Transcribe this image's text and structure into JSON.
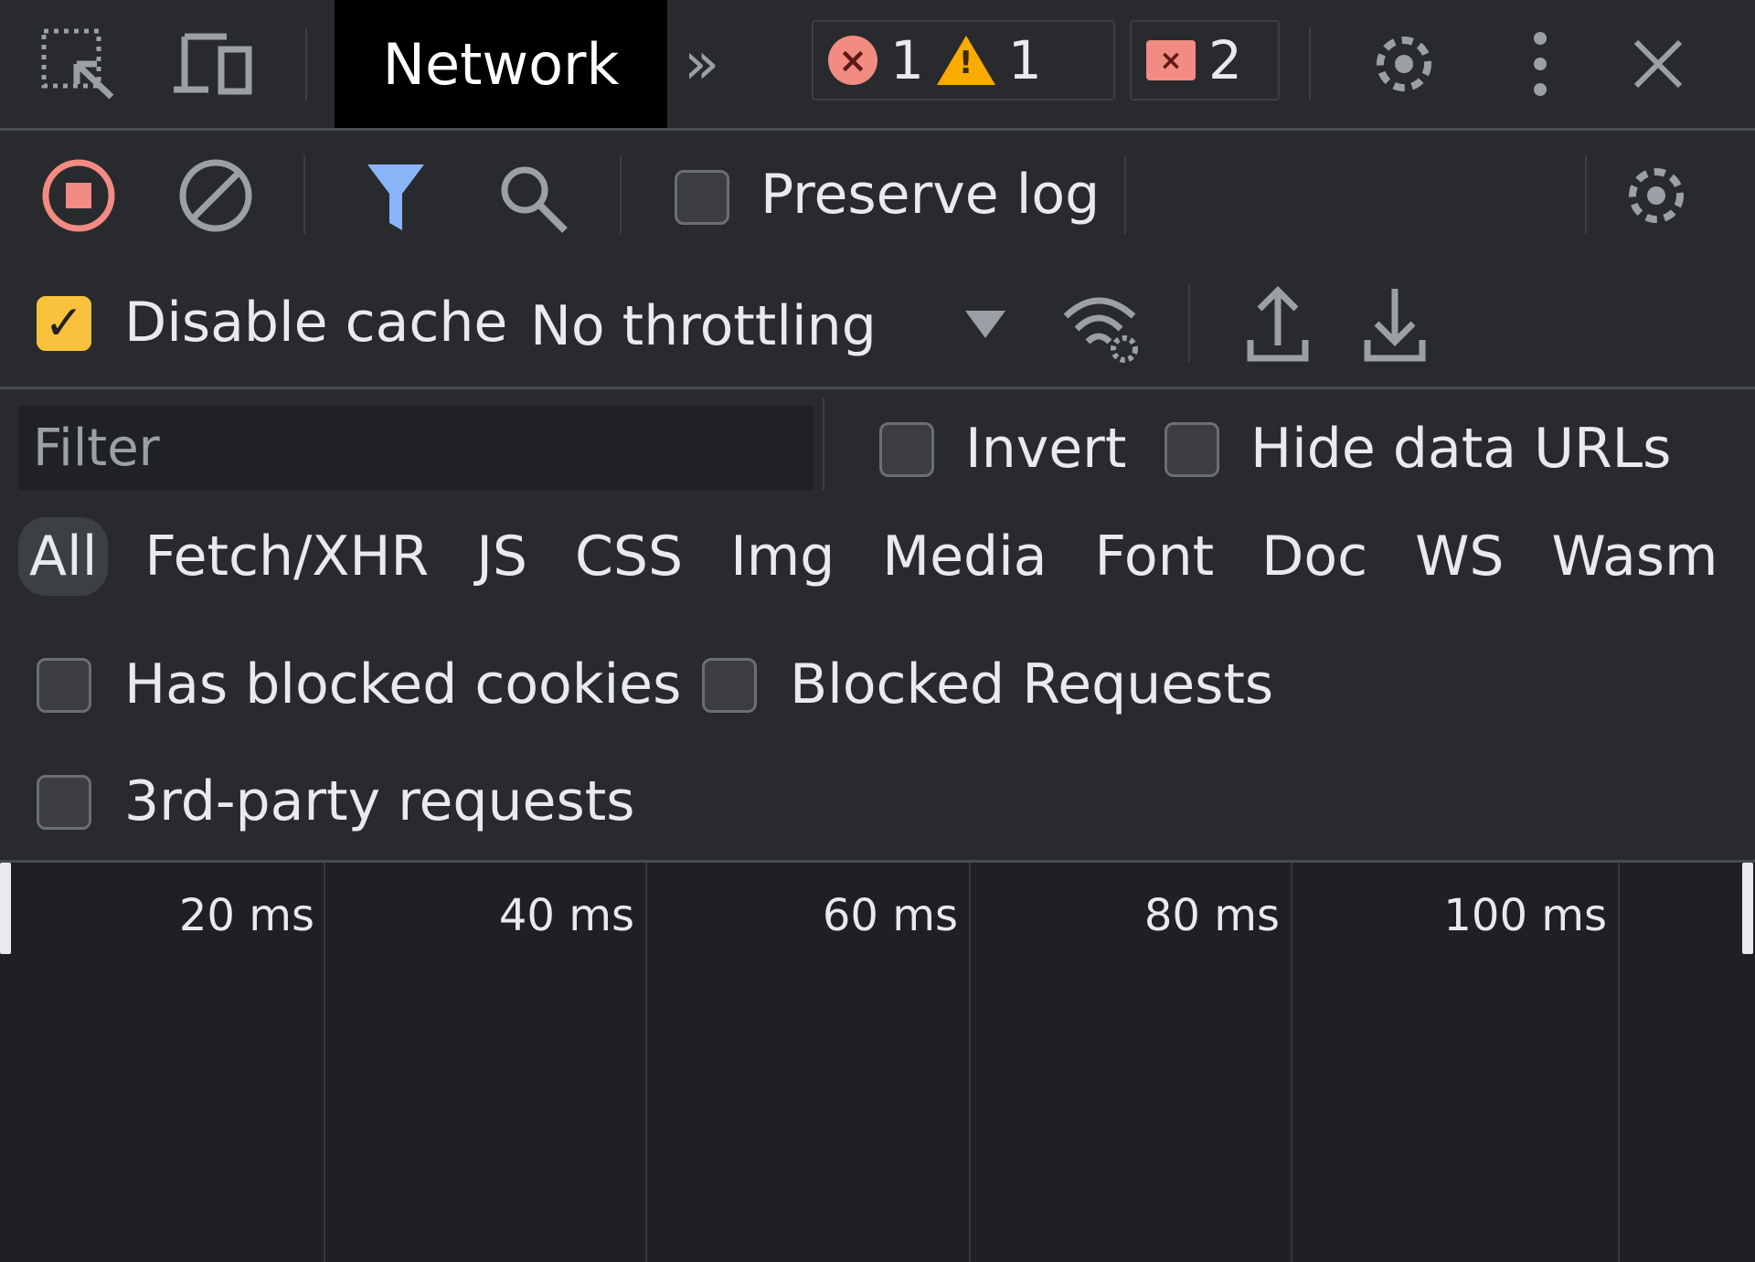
{
  "topbar": {
    "inspect_icon": "inspect-element-icon",
    "device_icon": "device-toolbar-icon",
    "active_tab": "Network",
    "more_tabs_icon": "chevron-double-right-icon",
    "error_count": "1",
    "warning_count": "1",
    "issues_count": "2",
    "settings_icon": "gear-icon",
    "menu_icon": "kebab-menu-icon",
    "close_icon": "close-icon"
  },
  "toolbar": {
    "record_icon": "stop-recording-icon",
    "clear_icon": "clear-icon",
    "filter_icon": "filter-icon",
    "search_icon": "search-icon",
    "preserve_log_label": "Preserve log",
    "preserve_log_checked": false,
    "settings_icon": "gear-icon",
    "disable_cache_label": "Disable cache",
    "disable_cache_checked": true,
    "throttling_value": "No throttling",
    "network_conditions_icon": "wifi-settings-icon",
    "import_icon": "upload-icon",
    "export_icon": "download-icon"
  },
  "filter": {
    "placeholder": "Filter",
    "value": "",
    "invert_label": "Invert",
    "hide_data_urls_label": "Hide data URLs",
    "types": [
      "All",
      "Fetch/XHR",
      "JS",
      "CSS",
      "Img",
      "Media",
      "Font",
      "Doc",
      "WS",
      "Wasm"
    ],
    "active_type": "All",
    "has_blocked_cookies_label": "Has blocked cookies",
    "blocked_requests_label": "Blocked Requests",
    "third_party_label": "3rd-party requests"
  },
  "timeline": {
    "ticks": [
      "20 ms",
      "40 ms",
      "60 ms",
      "80 ms",
      "100 ms"
    ]
  },
  "colors": {
    "record": "#f28b82",
    "filter_active": "#8ab4f8",
    "checkbox_checked": "#f9c23c",
    "warning": "#f9ab00"
  }
}
